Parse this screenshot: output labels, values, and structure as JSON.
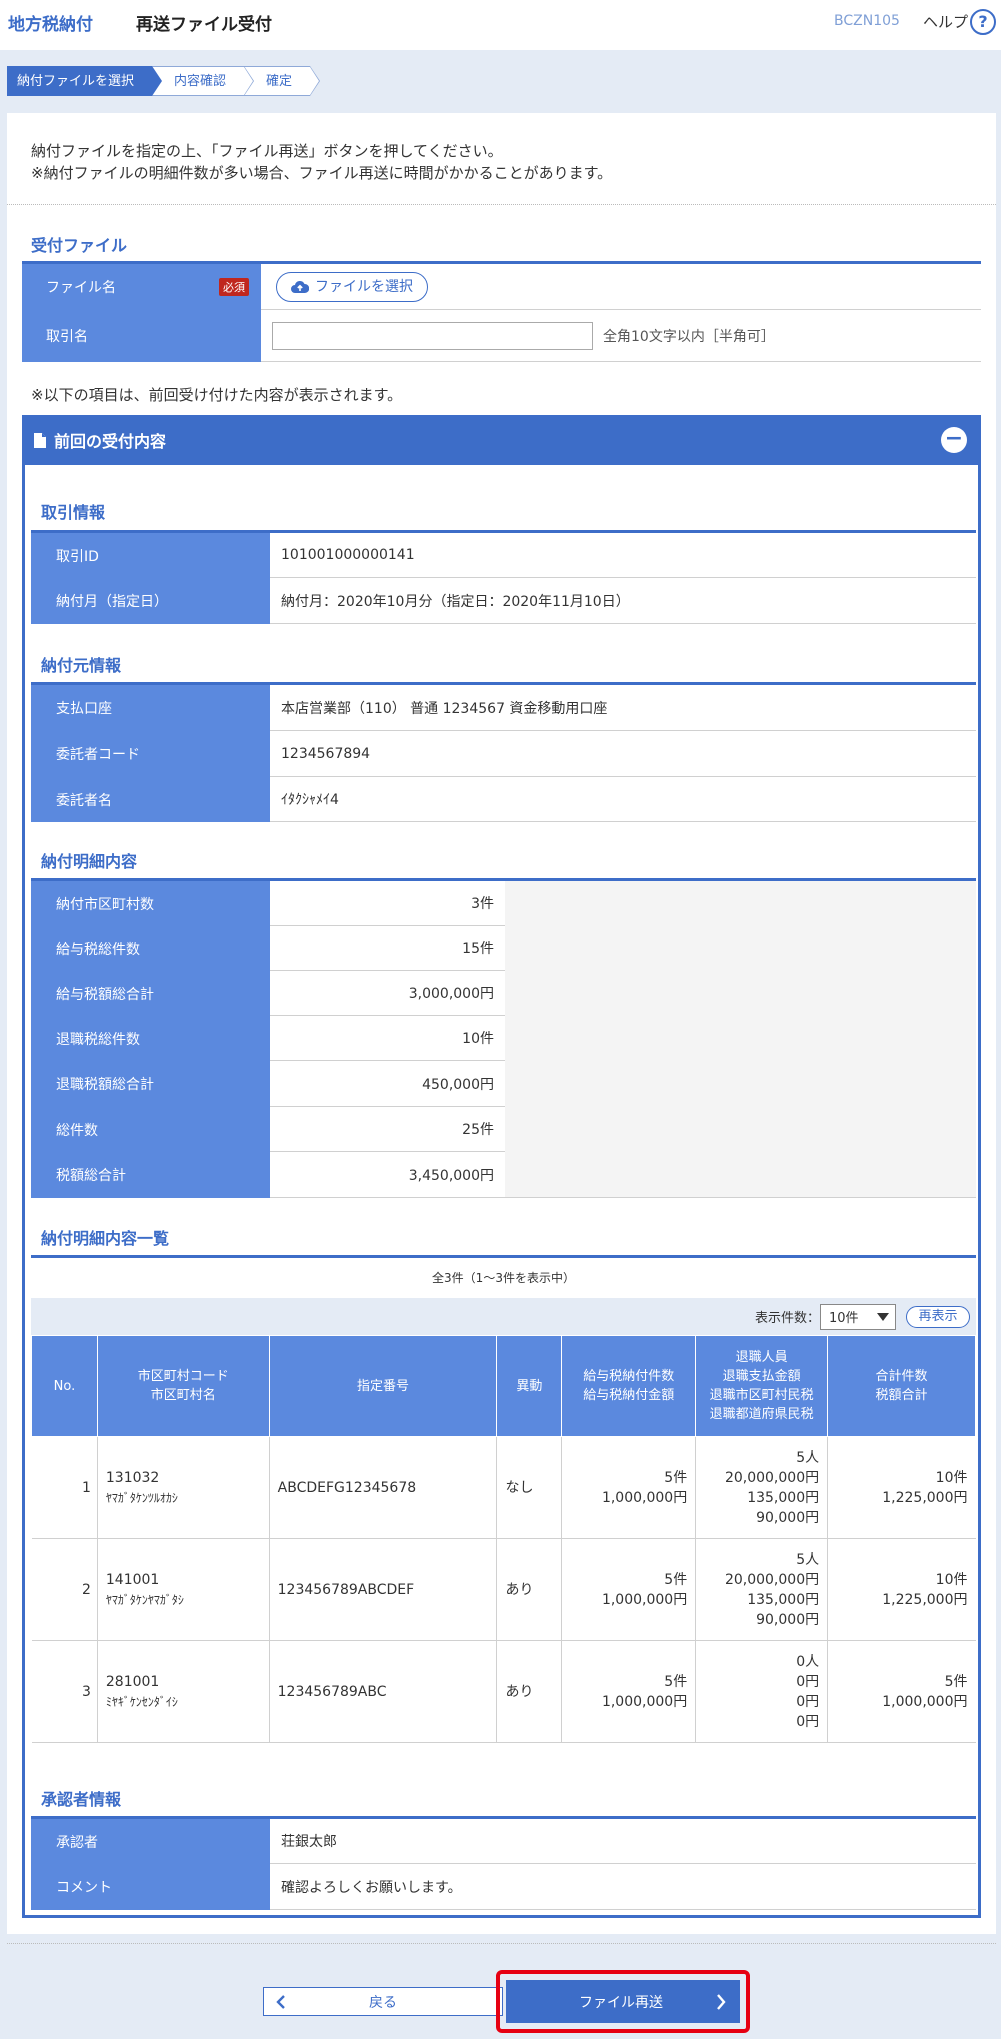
{
  "header": {
    "title": "地方税納付",
    "subtitle": "再送ファイル受付",
    "screen_id": "BCZN105",
    "help_label": "ヘルプ",
    "help_icon_glyph": "?"
  },
  "steps": [
    "納付ファイルを選択",
    "内容確認",
    "確定"
  ],
  "intro": {
    "line1": "納付ファイルを指定の上、「ファイル再送」ボタンを押してください。",
    "line2": "※納付ファイルの明細件数が多い場合、ファイル再送に時間がかかることがあります。"
  },
  "upload": {
    "title": "受付ファイル",
    "file_label": "ファイル名",
    "required_badge": "必須",
    "file_button": "ファイルを選択",
    "trade_label": "取引名",
    "trade_value": "",
    "trade_note": "全角10文字以内［半角可］"
  },
  "previous_note": "※以下の項目は、前回受け付けた内容が表示されます。",
  "previous": {
    "title": "前回の受付内容",
    "trade_info": {
      "title": "取引情報",
      "rows": [
        {
          "label": "取引ID",
          "value": "101001000000141"
        },
        {
          "label": "納付月（指定日）",
          "value": "納付月：2020年10月分（指定日：2020年11月10日）"
        }
      ]
    },
    "payer_info": {
      "title": "納付元情報",
      "rows": [
        {
          "label": "支払口座",
          "value": "本店営業部（110） 普通 1234567 資金移動用口座"
        },
        {
          "label": "委託者コード",
          "value": "1234567894"
        },
        {
          "label": "委託者名",
          "value": "ｲﾀｸｼｬﾒｲ4"
        }
      ]
    },
    "detail_summary": {
      "title": "納付明細内容",
      "rows": [
        {
          "label": "納付市区町村数",
          "value": "3件"
        },
        {
          "label": "給与税総件数",
          "value": "15件"
        },
        {
          "label": "給与税額総合計",
          "value": "3,000,000円"
        },
        {
          "label": "退職税総件数",
          "value": "10件"
        },
        {
          "label": "退職税額総合計",
          "value": "450,000円"
        },
        {
          "label": "総件数",
          "value": "25件"
        },
        {
          "label": "税額総合計",
          "value": "3,450,000円"
        }
      ]
    },
    "detail_list": {
      "title": "納付明細内容一覧",
      "count_text": "全3件（1～3件を表示中）",
      "page_size_label": "表示件数：",
      "page_size_value": "10件",
      "redisplay_button": "再表示",
      "headers": {
        "no": "No.",
        "city_code": "市区町村コード",
        "city_name": "市区町村名",
        "designated": "指定番号",
        "change": "異動",
        "salary_count": "給与税納付件数",
        "salary_amount": "給与税納付金額",
        "retire_people": "退職人員",
        "retire_pay": "退職支払金額",
        "retire_city_tax": "退職市区町村民税",
        "retire_pref_tax": "退職都道府県民税",
        "total_count": "合計件数",
        "total_tax": "税額合計"
      },
      "rows": [
        {
          "no": "1",
          "code": "131032",
          "name": "ﾔﾏｶﾞﾀｹﾝﾂﾙｵｶｼ",
          "designated": "ABCDEFG12345678",
          "change": "なし",
          "salary_count": "5件",
          "salary_amount": "1,000,000円",
          "retire_people": "5人",
          "retire_pay": "20,000,000円",
          "retire_city": "135,000円",
          "retire_pref": "90,000円",
          "total_count": "10件",
          "total_tax": "1,225,000円"
        },
        {
          "no": "2",
          "code": "141001",
          "name": "ﾔﾏｶﾞﾀｹﾝﾔﾏｶﾞﾀｼ",
          "designated": "123456789ABCDEF",
          "change": "あり",
          "salary_count": "5件",
          "salary_amount": "1,000,000円",
          "retire_people": "5人",
          "retire_pay": "20,000,000円",
          "retire_city": "135,000円",
          "retire_pref": "90,000円",
          "total_count": "10件",
          "total_tax": "1,225,000円"
        },
        {
          "no": "3",
          "code": "281001",
          "name": "ﾐﾔｷﾞｹﾝｾﾝﾀﾞｲｼ",
          "designated": "123456789ABC",
          "change": "あり",
          "salary_count": "5件",
          "salary_amount": "1,000,000円",
          "retire_people": "0人",
          "retire_pay": "0円",
          "retire_city": "0円",
          "retire_pref": "0円",
          "total_count": "5件",
          "total_tax": "1,000,000円"
        }
      ]
    },
    "approver": {
      "title": "承認者情報",
      "rows": [
        {
          "label": "承認者",
          "value": "荘銀太郎"
        },
        {
          "label": "コメント",
          "value": "確認よろしくお願いします。"
        }
      ]
    }
  },
  "buttons": {
    "back": "戻る",
    "resend": "ファイル再送"
  },
  "colors": {
    "accent": "#3d6dc8",
    "label_bg": "#5b89de",
    "frame_bg": "#e4ebf5",
    "highlight": "#e60012"
  }
}
